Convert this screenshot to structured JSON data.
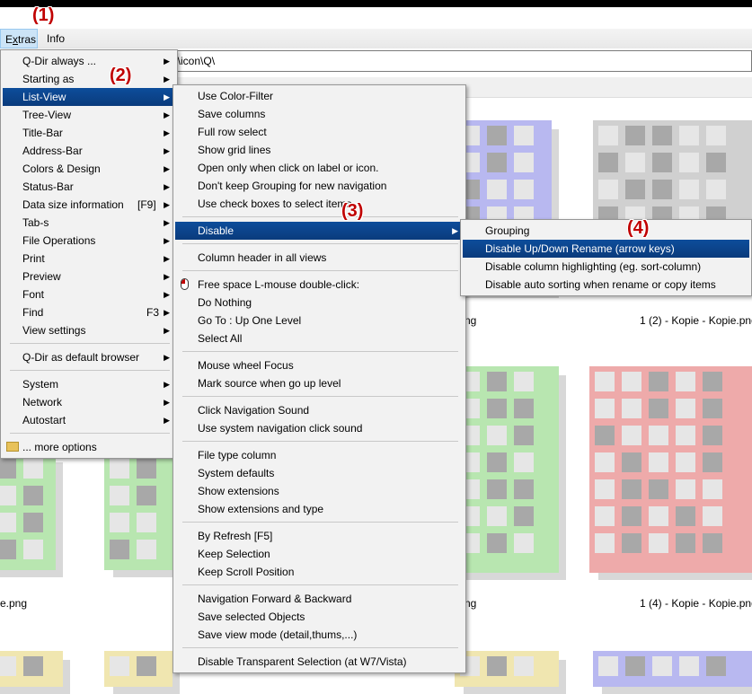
{
  "menubar": {
    "items": [
      {
        "label": "Extras",
        "hotkey_underline": "x"
      },
      {
        "label": "Info"
      }
    ]
  },
  "address": {
    "path": "g\\icon\\Q\\"
  },
  "annotations": {
    "a1": "(1)",
    "a2": "(2)",
    "a3": "(3)",
    "a4": "(4)"
  },
  "extras_menu": {
    "items": [
      {
        "label": "Q-Dir always ...",
        "arrow": "▶"
      },
      {
        "label": "Starting as",
        "arrow": "▶"
      },
      {
        "label": "List-View",
        "arrow": "▶"
      },
      {
        "label": "Tree-View",
        "arrow": "▶"
      },
      {
        "label": "Title-Bar",
        "arrow": "▶"
      },
      {
        "label": "Address-Bar",
        "arrow": "▶"
      },
      {
        "label": "Colors & Design",
        "arrow": "▶"
      },
      {
        "label": "Status-Bar",
        "arrow": "▶"
      },
      {
        "label": "Data size information",
        "shortcut": "[F9]",
        "arrow": "▶"
      },
      {
        "label": "Tab-s",
        "arrow": "▶"
      },
      {
        "label": "File Operations",
        "arrow": "▶"
      },
      {
        "label": "Print",
        "arrow": "▶"
      },
      {
        "label": "Preview",
        "arrow": "▶"
      },
      {
        "label": "Font",
        "arrow": "▶"
      },
      {
        "label": "Find",
        "shortcut": "F3",
        "arrow": "▶"
      },
      {
        "label": "View settings",
        "arrow": "▶"
      },
      {
        "label": "Q-Dir as default browser",
        "arrow": "▶"
      },
      {
        "label": "System",
        "arrow": "▶"
      },
      {
        "label": "Network",
        "arrow": "▶"
      },
      {
        "label": "Autostart",
        "arrow": "▶"
      },
      {
        "label": "... more options"
      }
    ]
  },
  "listview_menu": {
    "items": [
      {
        "label": "Use Color-Filter"
      },
      {
        "label": "Save columns"
      },
      {
        "label": "Full row select"
      },
      {
        "label": "Show grid lines"
      },
      {
        "label": "Open only when click on label or icon."
      },
      {
        "label": "Don't keep Grouping for new navigation"
      },
      {
        "label": "Use check boxes to select items"
      },
      {
        "label": "Disable",
        "arrow": "▶"
      },
      {
        "label": "Column header in all views"
      },
      {
        "label": "Free space L-mouse double-click:"
      },
      {
        "label": "Do Nothing"
      },
      {
        "label": "Go To : Up One Level"
      },
      {
        "label": "Select All"
      },
      {
        "label": "Mouse wheel Focus"
      },
      {
        "label": "Mark source when go up level"
      },
      {
        "label": "Click Navigation Sound"
      },
      {
        "label": "Use system navigation click sound"
      },
      {
        "label": "File type column"
      },
      {
        "label": "System defaults"
      },
      {
        "label": "Show extensions"
      },
      {
        "label": "Show extensions and type"
      },
      {
        "label": "By Refresh [F5]"
      },
      {
        "label": "Keep Selection"
      },
      {
        "label": "Keep Scroll Position"
      },
      {
        "label": "Navigation Forward & Backward"
      },
      {
        "label": "Save selected Objects"
      },
      {
        "label": "Save view mode (detail,thums,...)"
      },
      {
        "label": "Disable Transparent Selection (at W7/Vista)"
      }
    ]
  },
  "disable_menu": {
    "items": [
      {
        "label": "Grouping"
      },
      {
        "label": "Disable Up/Down Rename (arrow keys)"
      },
      {
        "label": "Disable column highlighting (eg. sort-column)"
      },
      {
        "label": "Disable auto sorting when rename or copy items"
      }
    ]
  },
  "files": {
    "cap_a": "ng",
    "cap_b": "1 (2) - Kopie - Kopie.png",
    "cap_c": "e.png",
    "cap_d": "ng",
    "cap_e": "1 (4) - Kopie - Kopie.png"
  },
  "colors": {
    "menu_highlight": "#0a3b7c",
    "annotation": "#c00000",
    "thumb_blue": "#b8b8f0",
    "thumb_gray": "#d0d0d0",
    "thumb_green": "#b8e6b0",
    "thumb_red": "#eeaaaa",
    "thumb_yellow": "#f0e6b0"
  }
}
